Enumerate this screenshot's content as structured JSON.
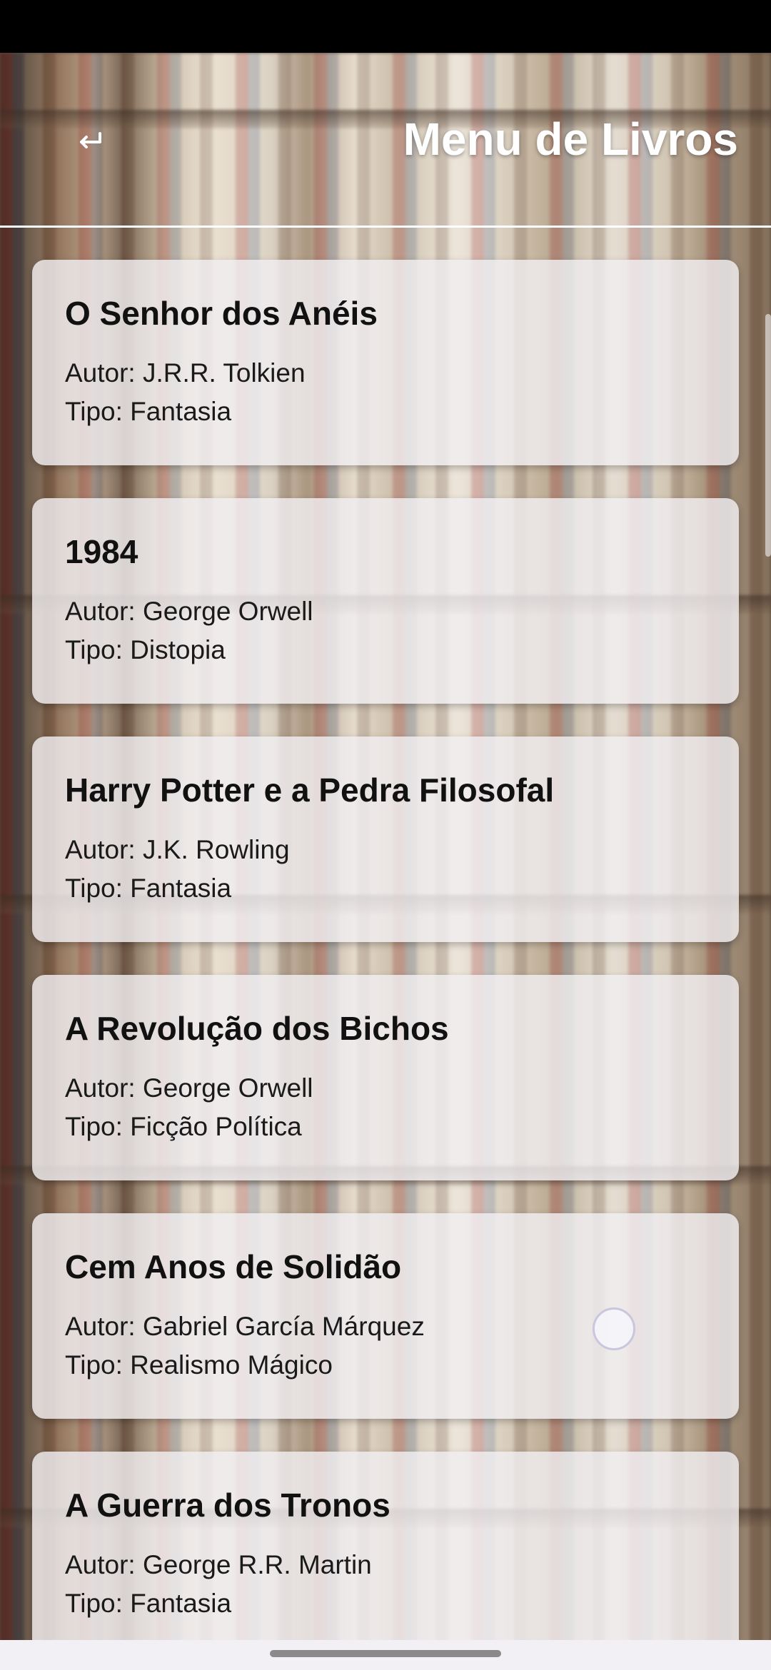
{
  "app_bar": {
    "title": "Menu de Livros",
    "back_icon": "back-arrow-icon"
  },
  "books": [
    {
      "title": "O Senhor dos Anéis",
      "author": "Autor: J.R.R. Tolkien",
      "type": "Tipo: Fantasia"
    },
    {
      "title": "1984",
      "author": "Autor: George Orwell",
      "type": "Tipo: Distopia"
    },
    {
      "title": "Harry Potter e a Pedra Filosofal",
      "author": "Autor: J.K. Rowling",
      "type": "Tipo: Fantasia"
    },
    {
      "title": "A Revolução dos Bichos",
      "author": "Autor: George Orwell",
      "type": "Tipo: Ficção Política"
    },
    {
      "title": "Cem Anos de Solidão",
      "author": "Autor: Gabriel García Márquez",
      "type": "Tipo: Realismo Mágico"
    },
    {
      "title": "A Guerra dos Tronos",
      "author": "Autor: George R.R. Martin",
      "type": "Tipo: Fantasia"
    }
  ],
  "colors": {
    "title_text": "#ffffff",
    "card_background": "#f0eef0"
  }
}
